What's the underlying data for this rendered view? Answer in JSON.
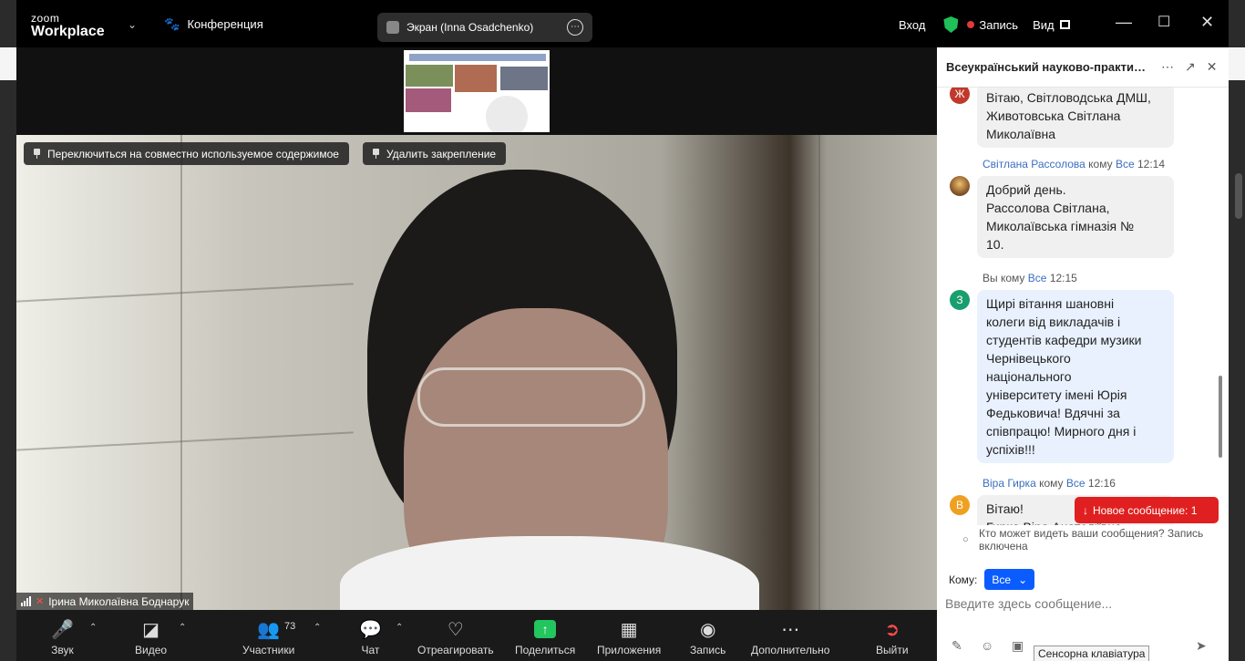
{
  "window": {
    "logo_top": "zoom",
    "logo_bottom": "Workplace",
    "conference_label": "Конференция",
    "screen_label": "Экран (Inna Osadchenko)",
    "signin_label": "Вход",
    "record_label": "Запись",
    "view_label": "Вид"
  },
  "video": {
    "switch_button": "Переключиться на совместно используемое содержимое",
    "unpin_button": "Удалить закрепление",
    "participant_name": "Ірина Миколаївна Боднарук"
  },
  "toolbar": {
    "audio": "Звук",
    "video": "Видео",
    "participants": "Участники",
    "participants_count": "73",
    "chat": "Чат",
    "react": "Отреагировать",
    "share": "Поделиться",
    "apps": "Приложения",
    "record": "Запись",
    "more": "Дополнительно",
    "leave": "Выйти"
  },
  "chat": {
    "title": "Всеукраїнський науково-практич...",
    "messages": [
      {
        "avatar": "Ж",
        "color": "#c0392b",
        "lines": [
          "Вітаю, Світловодська ДМШ,",
          "Животовська Світлана",
          "Миколаївна"
        ]
      },
      {
        "sender": "Світлана Рассолова",
        "to_word": "кому",
        "to": "Все",
        "time": "12:14",
        "avatar": "",
        "color": "#8a5a2b",
        "lines": [
          "Добрий день.",
          "Рассолова Світлана,",
          "Миколаївська гімназія №",
          "10."
        ]
      },
      {
        "sender": "Вы",
        "to_word": "кому",
        "to": "Все",
        "time": "12:15",
        "avatar": "З",
        "color": "#1a9e6e",
        "lines": [
          "Щирі вітання шановні",
          "колеги від викладачів і",
          "студентів кафедри музики",
          "Чернівецького",
          "національного",
          "університету імені Юрія",
          "Федьковича! Вдячні за",
          "співпрацю! Мирного дня і",
          "успіхів!!!"
        ]
      },
      {
        "sender": "Віра Гирка",
        "to_word": "кому",
        "to": "Все",
        "time": "12:16",
        "avatar": "В",
        "color": "#f0a020",
        "lines": [
          "Вітаю!",
          "Гирка Віра Анатоліївна"
        ]
      }
    ],
    "new_message_button": "Новое сообщение: 1",
    "privacy_notice": "Кто может видеть ваши сообщения? Запись включена",
    "to_label": "Кому:",
    "to_value": "Все",
    "input_placeholder": "Введите здесь сообщение...",
    "tooltip": "Сенсорна клавіатура"
  },
  "icons": {
    "chevron": "chevron-down-icon",
    "paw": "paw-icon",
    "shield": "shield-check-icon",
    "more": "more-horizontal-icon",
    "popout": "popout-icon",
    "close": "close-icon"
  },
  "colors": {
    "accent": "#0b5cff",
    "record": "#e5383b",
    "share": "#22c55e",
    "new_message": "#e02020",
    "shield": "#1fbf5a"
  }
}
